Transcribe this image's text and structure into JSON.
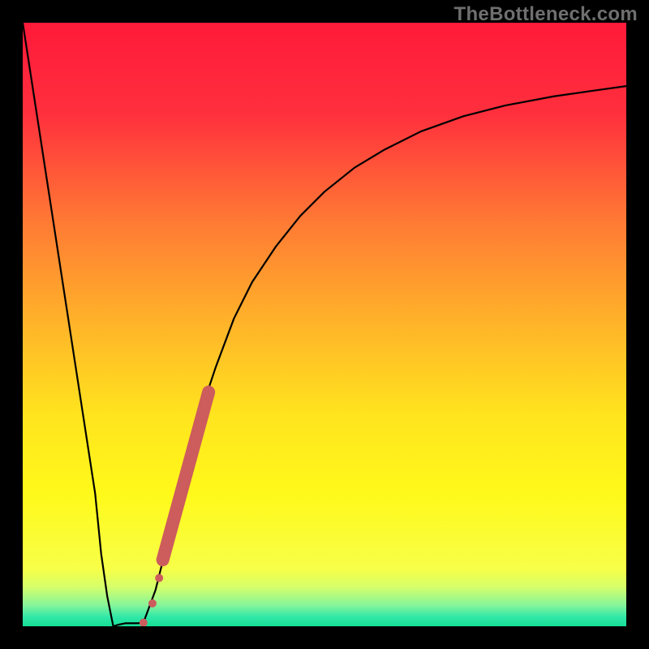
{
  "watermark": "TheBottleneck.com",
  "chart_data": {
    "type": "line",
    "title": "",
    "xlabel": "",
    "ylabel": "",
    "xlim": [
      0,
      100
    ],
    "ylim": [
      0,
      100
    ],
    "grid": false,
    "gradient_stops": [
      {
        "offset": 0.0,
        "color": "#ff1a3a"
      },
      {
        "offset": 0.15,
        "color": "#ff2f3d"
      },
      {
        "offset": 0.33,
        "color": "#ff7a34"
      },
      {
        "offset": 0.5,
        "color": "#ffb429"
      },
      {
        "offset": 0.65,
        "color": "#ffe41e"
      },
      {
        "offset": 0.78,
        "color": "#fff91a"
      },
      {
        "offset": 0.905,
        "color": "#f7ff48"
      },
      {
        "offset": 0.935,
        "color": "#d5ff6a"
      },
      {
        "offset": 0.965,
        "color": "#86f59a"
      },
      {
        "offset": 0.985,
        "color": "#2fe8a8"
      },
      {
        "offset": 1.0,
        "color": "#17de95"
      }
    ],
    "series": [
      {
        "name": "bottleneck-curve-left",
        "x": [
          0,
          2,
          4,
          6,
          8,
          10,
          12,
          13,
          14,
          15
        ],
        "y": [
          100,
          87,
          74,
          61,
          48,
          35,
          22,
          12,
          5,
          0
        ]
      },
      {
        "name": "bottleneck-curve-valley",
        "x": [
          15,
          16,
          17,
          18,
          19,
          20
        ],
        "y": [
          0,
          0.3,
          0.5,
          0.5,
          0.5,
          0.6
        ]
      },
      {
        "name": "bottleneck-curve-right",
        "x": [
          20,
          22,
          24,
          26,
          28,
          30,
          32,
          35,
          38,
          42,
          46,
          50,
          55,
          60,
          66,
          73,
          80,
          88,
          95,
          100
        ],
        "y": [
          0.6,
          6,
          14,
          22,
          30,
          37,
          43,
          51,
          57,
          63,
          68,
          72,
          76,
          79,
          82,
          84.5,
          86.3,
          87.8,
          88.8,
          89.5
        ]
      }
    ],
    "markers": {
      "name": "highlight-band",
      "color": "#cd5c5c",
      "points": [
        {
          "x": 20.0,
          "y": 0.6,
          "r": 5
        },
        {
          "x": 21.5,
          "y": 3.8,
          "r": 5
        },
        {
          "x": 22.6,
          "y": 8.0,
          "r": 5
        },
        {
          "x": 23.2,
          "y": 11.0,
          "r": 6
        }
      ],
      "band": {
        "x0": 23.2,
        "y0": 11.0,
        "x1": 30.8,
        "y1": 38.8,
        "width": 16
      }
    }
  }
}
